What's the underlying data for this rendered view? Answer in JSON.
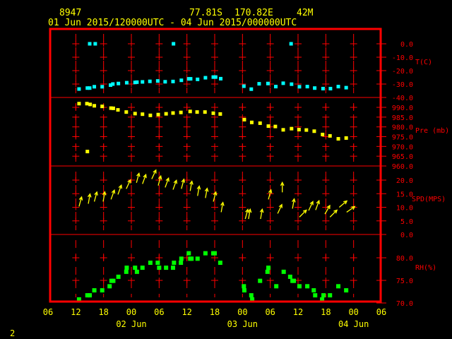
{
  "header": {
    "station": "8947",
    "lat": "77.81S",
    "lon": "170.82E",
    "elev": "42M",
    "period": "01 Jun 2015/120000UTC - 04 Jun 2015/000000UTC"
  },
  "page_number": "2",
  "colors": {
    "frame": "#ff0000",
    "temp": "#00ffff",
    "pres": "#ffff00",
    "wind": "#ffff00",
    "rh": "#00ff00",
    "text": "#ffff00"
  },
  "chart_data": {
    "type": "scatter",
    "x_unit": "hours since 01 Jun 06UTC",
    "xlim": [
      0,
      72
    ],
    "x_ticks": [
      "06",
      "12",
      "18",
      "00",
      "06",
      "12",
      "18",
      "00",
      "06",
      "12",
      "18",
      "00",
      "06"
    ],
    "date_labels": [
      {
        "label": "02 Jun",
        "h": 18
      },
      {
        "label": "03 Jun",
        "h": 42
      },
      {
        "label": "04 Jun",
        "h": 66
      }
    ],
    "panels": [
      {
        "key": "temp",
        "label": "T(C)",
        "ylim": [
          -40,
          10
        ],
        "ticks": [
          "0.0",
          "-10.0",
          "-20.0",
          "-30.0",
          "-40.0"
        ],
        "tick_values": [
          0,
          -10,
          -20,
          -30,
          -40
        ],
        "points": [
          [
            6.7,
            -33.7
          ],
          [
            8.5,
            -33
          ],
          [
            9,
            -33
          ],
          [
            10,
            -32
          ],
          [
            11.7,
            -32
          ],
          [
            13.5,
            -30.8
          ],
          [
            14,
            -30
          ],
          [
            15.2,
            -29.6
          ],
          [
            17,
            -29
          ],
          [
            18.8,
            -28.8
          ],
          [
            19.2,
            -28.6
          ],
          [
            20.4,
            -28.4
          ],
          [
            22,
            -28
          ],
          [
            23.7,
            -27.7
          ],
          [
            25.3,
            -28.3
          ],
          [
            27,
            -28.1
          ],
          [
            28.8,
            -27.2
          ],
          [
            30.4,
            -26.1
          ],
          [
            30.8,
            -26.1
          ],
          [
            32.3,
            -26.5
          ],
          [
            34,
            -25.3
          ],
          [
            35.7,
            -24.8
          ],
          [
            36.2,
            -24.8
          ],
          [
            37.3,
            -26
          ],
          [
            42.3,
            -31.6
          ],
          [
            43.9,
            -33.8
          ],
          [
            45.6,
            -29.8
          ],
          [
            47.5,
            -29.6
          ],
          [
            49.2,
            -31.9
          ],
          [
            50.8,
            -29.4
          ],
          [
            52.6,
            -30.1
          ],
          [
            54.3,
            -32
          ],
          [
            56,
            -31.9
          ],
          [
            57.6,
            -33
          ],
          [
            59.4,
            -33.4
          ],
          [
            61,
            -33.4
          ],
          [
            62.7,
            -31.9
          ],
          [
            64.4,
            -32.7
          ],
          [
            9,
            0
          ],
          [
            10.2,
            0
          ],
          [
            27.1,
            0
          ],
          [
            52.5,
            0
          ]
        ]
      },
      {
        "key": "pres",
        "label": "Pre (mb)",
        "ylim": [
          960,
          995
        ],
        "ticks": [
          "990.0",
          "985.0",
          "980.0",
          "975.0",
          "970.0",
          "965.0",
          "960.0"
        ],
        "tick_values": [
          990,
          985,
          980,
          975,
          970,
          965,
          960
        ],
        "points": [
          [
            6.7,
            991.9
          ],
          [
            8.4,
            991.9
          ],
          [
            9.1,
            991.5
          ],
          [
            10,
            990.8
          ],
          [
            11.7,
            990.5
          ],
          [
            13.6,
            989.6
          ],
          [
            14.1,
            989.5
          ],
          [
            15.1,
            988.7
          ],
          [
            16.9,
            987.6
          ],
          [
            18.8,
            986.8
          ],
          [
            20.4,
            986.5
          ],
          [
            22.1,
            985.9
          ],
          [
            23.8,
            986.3
          ],
          [
            25.5,
            986.7
          ],
          [
            27,
            987.1
          ],
          [
            28.7,
            987.4
          ],
          [
            30.7,
            987.9
          ],
          [
            32.2,
            987.6
          ],
          [
            33.9,
            987.6
          ],
          [
            35.7,
            987
          ],
          [
            37.2,
            986.6
          ],
          [
            42.4,
            983.7
          ],
          [
            44,
            982.3
          ],
          [
            45.8,
            981.9
          ],
          [
            47.6,
            980.4
          ],
          [
            49.1,
            980.2
          ],
          [
            50.8,
            978.5
          ],
          [
            52.6,
            979.1
          ],
          [
            54.2,
            978.6
          ],
          [
            55.8,
            978.4
          ],
          [
            57.5,
            977.8
          ],
          [
            59.3,
            976.1
          ],
          [
            60.9,
            975.4
          ],
          [
            62.7,
            973.9
          ],
          [
            64.4,
            974.3
          ],
          [
            8.5,
            967.4
          ]
        ]
      },
      {
        "key": "wind",
        "label": "SPD(MPS)",
        "ylim": [
          0,
          25
        ],
        "ticks": [
          "20.0",
          "15.0",
          "10.0",
          "5.0",
          "0.0"
        ],
        "tick_values": [
          20,
          15,
          10,
          5,
          0
        ],
        "points": [
          [
            6.7,
            10.3,
            15
          ],
          [
            8.7,
            11.3,
            10
          ],
          [
            10,
            12.1,
            15
          ],
          [
            11.9,
            12.1,
            10
          ],
          [
            13.6,
            12.9,
            20
          ],
          [
            15.1,
            14.7,
            20
          ],
          [
            16.9,
            16.8,
            25
          ],
          [
            19.1,
            19,
            15
          ],
          [
            20.4,
            18.6,
            20
          ],
          [
            22.4,
            20.4,
            25
          ],
          [
            23.8,
            18,
            15
          ],
          [
            25.3,
            17.3,
            20
          ],
          [
            27,
            16.5,
            20
          ],
          [
            28.8,
            16.8,
            15
          ],
          [
            30.7,
            16,
            10
          ],
          [
            32.3,
            14.2,
            10
          ],
          [
            34,
            13.4,
            10
          ],
          [
            35.7,
            12.1,
            15
          ],
          [
            37.4,
            8.2,
            10
          ],
          [
            42.6,
            5.7,
            15
          ],
          [
            43.3,
            5.7,
            10
          ],
          [
            45.9,
            5.7,
            10
          ],
          [
            47.6,
            12.9,
            15
          ],
          [
            49.6,
            7.7,
            25
          ],
          [
            50.6,
            15.5,
            0
          ],
          [
            52.8,
            9.5,
            10
          ],
          [
            54.3,
            6.4,
            45
          ],
          [
            56.3,
            8.8,
            25
          ],
          [
            57.8,
            9,
            20
          ],
          [
            59.8,
            7.5,
            30
          ],
          [
            60.9,
            6.4,
            45
          ],
          [
            62.9,
            10,
            50
          ],
          [
            64.5,
            8.2,
            55
          ]
        ]
      },
      {
        "key": "rh",
        "label": "RH(%)",
        "ylim": [
          70,
          85
        ],
        "ticks": [
          "80.0",
          "75.0",
          "70.0"
        ],
        "tick_values": [
          80,
          75,
          70
        ],
        "points": [
          [
            6.7,
            70.8
          ],
          [
            8.5,
            71.7
          ],
          [
            9,
            71.7
          ],
          [
            10,
            72.8
          ],
          [
            11.7,
            72.8
          ],
          [
            13.3,
            73.7
          ],
          [
            13.7,
            74.9
          ],
          [
            14.1,
            74.9
          ],
          [
            15.2,
            75.8
          ],
          [
            16.9,
            76.9
          ],
          [
            17,
            77.8
          ],
          [
            18.8,
            77.8
          ],
          [
            19.2,
            76.9
          ],
          [
            20.4,
            77.8
          ],
          [
            22.1,
            78.9
          ],
          [
            23.7,
            78.9
          ],
          [
            24,
            77.8
          ],
          [
            25.5,
            77.8
          ],
          [
            27,
            77.8
          ],
          [
            27.2,
            78.9
          ],
          [
            28.7,
            78.9
          ],
          [
            28.8,
            79.8
          ],
          [
            30.4,
            81
          ],
          [
            30.7,
            79.8
          ],
          [
            31,
            79.8
          ],
          [
            32.3,
            79.8
          ],
          [
            34,
            81
          ],
          [
            35.7,
            81
          ],
          [
            36,
            81
          ],
          [
            37.2,
            78.9
          ],
          [
            42.3,
            73.7
          ],
          [
            42.4,
            72.8
          ],
          [
            43.9,
            71.7
          ],
          [
            44.1,
            70.8
          ],
          [
            45.8,
            74.9
          ],
          [
            47.6,
            77.8
          ],
          [
            47.4,
            76.9
          ],
          [
            49.3,
            73.7
          ],
          [
            50.9,
            76.9
          ],
          [
            52.3,
            75.8
          ],
          [
            52.8,
            74.9
          ],
          [
            53.1,
            74.9
          ],
          [
            54.3,
            73.7
          ],
          [
            56,
            73.7
          ],
          [
            57.4,
            72.8
          ],
          [
            57.7,
            71.7
          ],
          [
            59.2,
            70.8
          ],
          [
            59.5,
            71.7
          ],
          [
            60.9,
            71.7
          ],
          [
            62.7,
            73.7
          ],
          [
            64.4,
            72.8
          ]
        ]
      }
    ]
  }
}
